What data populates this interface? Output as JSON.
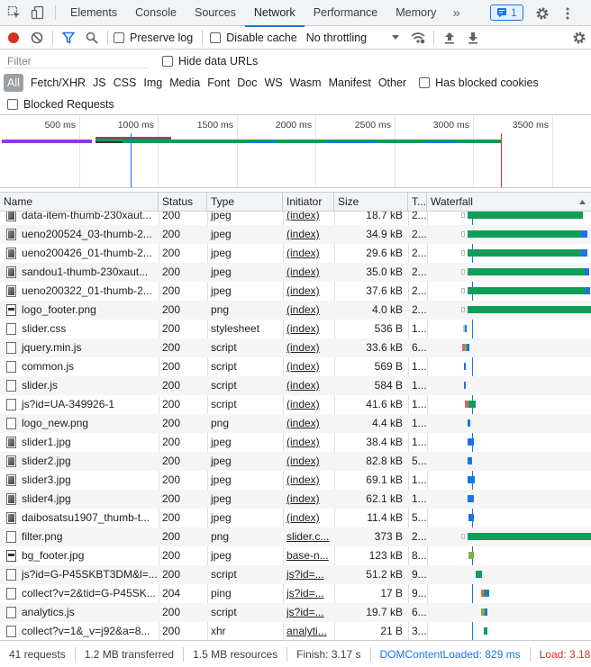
{
  "tabs": [
    {
      "label": "Elements",
      "active": false
    },
    {
      "label": "Console",
      "active": false
    },
    {
      "label": "Sources",
      "active": false
    },
    {
      "label": "Network",
      "active": true
    },
    {
      "label": "Performance",
      "active": false
    },
    {
      "label": "Memory",
      "active": false
    }
  ],
  "tabs_more": "»",
  "issues_count": "1",
  "toolbar": {
    "preserve_log": "Preserve log",
    "disable_cache": "Disable cache",
    "throttling": "No throttling"
  },
  "filter": {
    "placeholder": "Filter",
    "hide_data_urls": "Hide data URLs"
  },
  "type_filters": [
    "All",
    "Fetch/XHR",
    "JS",
    "CSS",
    "Img",
    "Media",
    "Font",
    "Doc",
    "WS",
    "Wasm",
    "Manifest",
    "Other"
  ],
  "has_blocked_cookies": "Has blocked cookies",
  "blocked_requests": "Blocked Requests",
  "overview_ticks": [
    "500 ms",
    "1000 ms",
    "1500 ms",
    "2000 ms",
    "2500 ms",
    "3000 ms",
    "3500 ms"
  ],
  "columns": {
    "name": "Name",
    "status": "Status",
    "type": "Type",
    "initiator": "Initiator",
    "size": "Size",
    "time": "T...",
    "waterfall": "Waterfall"
  },
  "rows": [
    {
      "name": "data-item-thumb-230xaut...",
      "status": "200",
      "type": "jpeg",
      "initiator": "(index)",
      "size": "18.7 kB",
      "time": "2...",
      "icon": "img"
    },
    {
      "name": "ueno200524_03-thumb-2...",
      "status": "200",
      "type": "jpeg",
      "initiator": "(index)",
      "size": "34.9 kB",
      "time": "2...",
      "icon": "img"
    },
    {
      "name": "ueno200426_01-thumb-2...",
      "status": "200",
      "type": "jpeg",
      "initiator": "(index)",
      "size": "29.6 kB",
      "time": "2...",
      "icon": "img"
    },
    {
      "name": "sandou1-thumb-230xaut...",
      "status": "200",
      "type": "jpeg",
      "initiator": "(index)",
      "size": "35.0 kB",
      "time": "2...",
      "icon": "img"
    },
    {
      "name": "ueno200322_01-thumb-2...",
      "status": "200",
      "type": "jpeg",
      "initiator": "(index)",
      "size": "37.6 kB",
      "time": "2...",
      "icon": "img"
    },
    {
      "name": "logo_footer.png",
      "status": "200",
      "type": "png",
      "initiator": "(index)",
      "size": "4.0 kB",
      "time": "2...",
      "icon": "png"
    },
    {
      "name": "slider.css",
      "status": "200",
      "type": "stylesheet",
      "initiator": "(index)",
      "size": "536 B",
      "time": "1...",
      "icon": "doc"
    },
    {
      "name": "jquery.min.js",
      "status": "200",
      "type": "script",
      "initiator": "(index)",
      "size": "33.6 kB",
      "time": "6...",
      "icon": "doc"
    },
    {
      "name": "common.js",
      "status": "200",
      "type": "script",
      "initiator": "(index)",
      "size": "569 B",
      "time": "1...",
      "icon": "doc"
    },
    {
      "name": "slider.js",
      "status": "200",
      "type": "script",
      "initiator": "(index)",
      "size": "584 B",
      "time": "1...",
      "icon": "doc"
    },
    {
      "name": "js?id=UA-349926-1",
      "status": "200",
      "type": "script",
      "initiator": "(index)",
      "size": "41.6 kB",
      "time": "1...",
      "icon": "doc"
    },
    {
      "name": "logo_new.png",
      "status": "200",
      "type": "png",
      "initiator": "(index)",
      "size": "4.4 kB",
      "time": "1...",
      "icon": "doc"
    },
    {
      "name": "slider1.jpg",
      "status": "200",
      "type": "jpeg",
      "initiator": "(index)",
      "size": "38.4 kB",
      "time": "1...",
      "icon": "img"
    },
    {
      "name": "slider2.jpg",
      "status": "200",
      "type": "jpeg",
      "initiator": "(index)",
      "size": "82.8 kB",
      "time": "5...",
      "icon": "img"
    },
    {
      "name": "slider3.jpg",
      "status": "200",
      "type": "jpeg",
      "initiator": "(index)",
      "size": "69.1 kB",
      "time": "1...",
      "icon": "img"
    },
    {
      "name": "slider4.jpg",
      "status": "200",
      "type": "jpeg",
      "initiator": "(index)",
      "size": "62.1 kB",
      "time": "1...",
      "icon": "img"
    },
    {
      "name": "daibosatsu1907_thumb-t...",
      "status": "200",
      "type": "jpeg",
      "initiator": "(index)",
      "size": "11.4 kB",
      "time": "5...",
      "icon": "img"
    },
    {
      "name": "filter.png",
      "status": "200",
      "type": "png",
      "initiator": "slider.c...",
      "size": "373 B",
      "time": "2...",
      "icon": "doc"
    },
    {
      "name": "bg_footer.jpg",
      "status": "200",
      "type": "jpeg",
      "initiator": "base-n...",
      "size": "123 kB",
      "time": "8...",
      "icon": "png"
    },
    {
      "name": "js?id=G-P45SKBT3DM&l=...",
      "status": "200",
      "type": "script",
      "initiator": "js?id=...",
      "size": "51.2 kB",
      "time": "9...",
      "icon": "doc"
    },
    {
      "name": "collect?v=2&tid=G-P45SK...",
      "status": "204",
      "type": "ping",
      "initiator": "js?id=...",
      "size": "17 B",
      "time": "9...",
      "icon": "doc"
    },
    {
      "name": "analytics.js",
      "status": "200",
      "type": "script",
      "initiator": "js?id=...",
      "size": "19.7 kB",
      "time": "6...",
      "icon": "doc"
    },
    {
      "name": "collect?v=1&_v=j92&a=8...",
      "status": "200",
      "type": "xhr",
      "initiator": "analyti...",
      "size": "21 B",
      "time": "3...",
      "icon": "doc"
    }
  ],
  "status_bar": {
    "requests": "41 requests",
    "transferred": "1.2 MB transferred",
    "resources": "1.5 MB resources",
    "finish": "Finish: 3.17 s",
    "dom_content_loaded": "DOMContentLoaded: 829 ms",
    "load": "Load: 3.18 s"
  },
  "colors": {
    "accent": "#1a73e8",
    "record": "#d93025",
    "waiting": "#0f9d58",
    "download": "#1a73e8",
    "load_line": "#d93025",
    "dcl_line": "#1a73e8"
  }
}
